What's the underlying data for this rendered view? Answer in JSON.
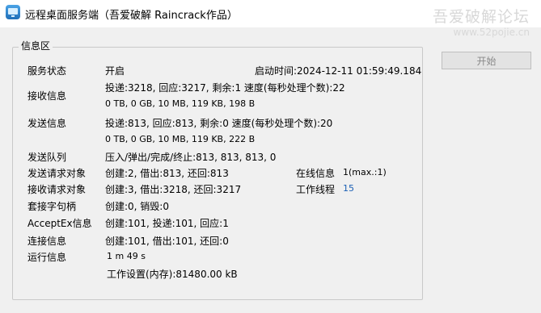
{
  "window": {
    "title": "远程桌面服务端（吾爱破解 Raincrack作品）",
    "watermark_line1": "吾爱破解论坛",
    "watermark_line2": "www.52pojie.cn"
  },
  "group": {
    "title": "信息区"
  },
  "rows": {
    "service_status": {
      "label": "服务状态",
      "value": "开启"
    },
    "start_time": "启动时间:2024-12-11 01:59:49.184",
    "recv": {
      "label": "接收信息",
      "line1": "投递:3218, 回应:3217, 剩余:1 速度(每秒处理个数):22",
      "line2": "0 TB, 0 GB, 10 MB, 119 KB, 198 B"
    },
    "send": {
      "label": "发送信息",
      "line1": "投递:813, 回应:813, 剩余:0 速度(每秒处理个数):20",
      "line2": "0 TB, 0 GB, 10 MB, 119 KB, 222 B"
    },
    "send_queue": {
      "label": "发送队列",
      "value": "压入/弹出/完成/终止:813, 813, 813, 0"
    },
    "send_req": {
      "label": "发送请求对象",
      "value": "创建:2, 借出:813, 还回:813"
    },
    "online": {
      "label": "在线信息",
      "value": "1(max.:1)"
    },
    "recv_req": {
      "label": "接收请求对象",
      "value": "创建:3, 借出:3218, 还回:3217"
    },
    "threads": {
      "label": "工作线程",
      "value": "15"
    },
    "socket": {
      "label": "套接字句柄",
      "value": "创建:0, 销毁:0"
    },
    "acceptex": {
      "label": "AcceptEx信息",
      "value": "创建:101, 投递:101, 回应:1"
    },
    "conn": {
      "label": "连接信息",
      "value": "创建:101, 借出:101, 还回:0"
    },
    "runtime": {
      "label": "运行信息",
      "value": "1 m 49 s"
    },
    "workset": "工作设置(内存):81480.00 kB"
  },
  "buttons": {
    "start": "开始"
  }
}
